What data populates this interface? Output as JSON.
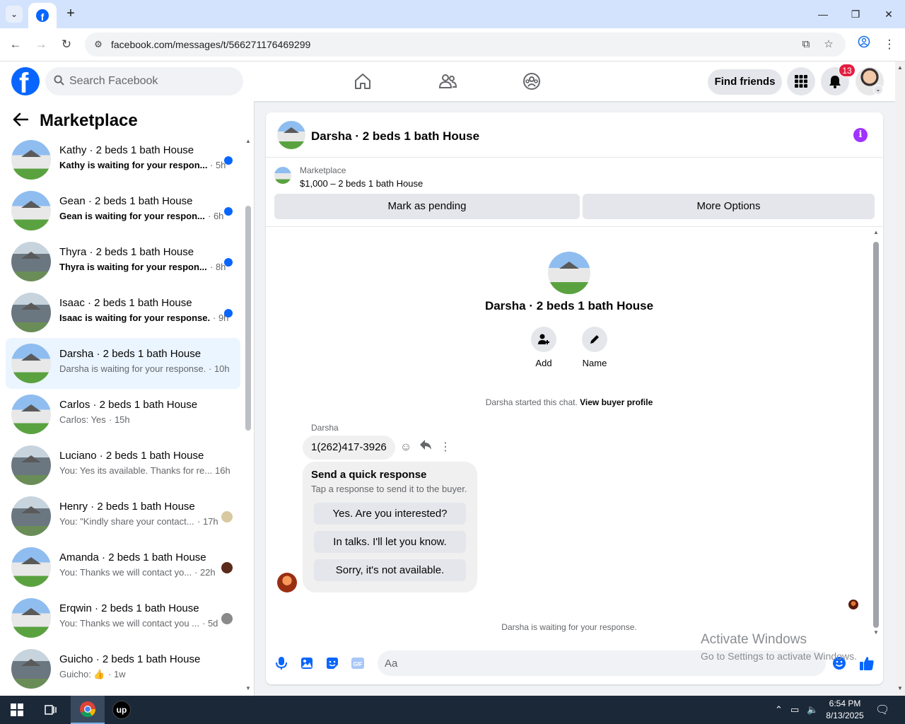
{
  "browser": {
    "url": "facebook.com/messages/t/566271176469299",
    "window_controls": {
      "minimize": "—",
      "restore": "❐",
      "close": "✕"
    }
  },
  "header": {
    "search_placeholder": "Search Facebook",
    "find_friends_label": "Find friends",
    "notification_count": "13"
  },
  "sidebar": {
    "title": "Marketplace",
    "conversations": [
      {
        "name": "Kathy · 2 beds 1 bath House",
        "snippet": "Kathy is waiting for your respon...",
        "time": "· 5h",
        "unread": true,
        "indicator": "dot",
        "thumb": "white"
      },
      {
        "name": "Gean · 2 beds 1 bath House",
        "snippet": "Gean is waiting for your respon...",
        "time": "· 6h",
        "unread": true,
        "indicator": "dot",
        "thumb": "white"
      },
      {
        "name": "Thyra · 2 beds 1 bath House",
        "snippet": "Thyra is waiting for your respon...",
        "time": "· 8h",
        "unread": true,
        "indicator": "dot",
        "thumb": "gray"
      },
      {
        "name": "Isaac · 2 beds 1 bath House",
        "snippet": "Isaac is waiting for your response.",
        "time": "· 9h",
        "unread": true,
        "indicator": "dot",
        "thumb": "gray"
      },
      {
        "name": "Darsha · 2 beds 1 bath House",
        "snippet": "Darsha is waiting for your response.",
        "time": "· 10h",
        "unread": false,
        "indicator": "none",
        "thumb": "white",
        "active": true
      },
      {
        "name": "Carlos · 2 beds 1 bath House",
        "snippet": "Carlos: Yes",
        "time": "· 15h",
        "unread": false,
        "indicator": "none",
        "thumb": "white"
      },
      {
        "name": "Luciano · 2 beds 1 bath House",
        "snippet": "You: Yes its available. Thanks for re...",
        "time": "16h",
        "unread": false,
        "indicator": "none",
        "thumb": "gray"
      },
      {
        "name": "Henry · 2 beds 1 bath House",
        "snippet": "You: \"Kindly share your contact...",
        "time": "· 17h",
        "unread": false,
        "indicator": "avatar",
        "avatar_color": "#d8c9a0",
        "thumb": "gray"
      },
      {
        "name": "Amanda · 2 beds 1 bath House",
        "snippet": "You: Thanks we will contact yo...",
        "time": "· 22h",
        "unread": false,
        "indicator": "avatar",
        "avatar_color": "#5a2a1a",
        "thumb": "white"
      },
      {
        "name": "Erqwin · 2 beds 1 bath House",
        "snippet": "You: Thanks we will contact you ...",
        "time": "· 5d",
        "unread": false,
        "indicator": "avatar",
        "avatar_color": "#8a8a8a",
        "thumb": "white"
      },
      {
        "name": "Guicho · 2 beds 1 bath House",
        "snippet": "Guicho: 👍",
        "time": "· 1w",
        "unread": false,
        "indicator": "none",
        "thumb": "gray"
      }
    ]
  },
  "chat": {
    "title": "Darsha · 2 beds 1 bath House",
    "marketplace_label": "Marketplace",
    "listing": "$1,000 – 2 beds 1 bath House",
    "mark_pending_label": "Mark as pending",
    "more_options_label": "More Options",
    "center_title": "Darsha · 2 beds 1 bath House",
    "add_label": "Add",
    "name_label": "Name",
    "started_text": "Darsha started this chat.",
    "view_profile_label": "View buyer profile",
    "sender_name": "Darsha",
    "phone_message": "1(262)417-3926",
    "quick_title": "Send a quick response",
    "quick_subtitle": "Tap a response to send it to the buyer.",
    "quick_replies": [
      "Yes. Are you interested?",
      "In talks. I'll let you know.",
      "Sorry, it's not available."
    ],
    "waiting_text": "Darsha is waiting for your response.",
    "composer_placeholder": "Aa"
  },
  "watermark": {
    "line1": "Activate Windows",
    "line2": "Go to Settings to activate Windows."
  },
  "taskbar": {
    "time": "6:54 PM",
    "date": "8/13/2025"
  },
  "colors": {
    "accent": "#0866ff",
    "info": "#a033ff",
    "badge": "#e41e3f"
  }
}
